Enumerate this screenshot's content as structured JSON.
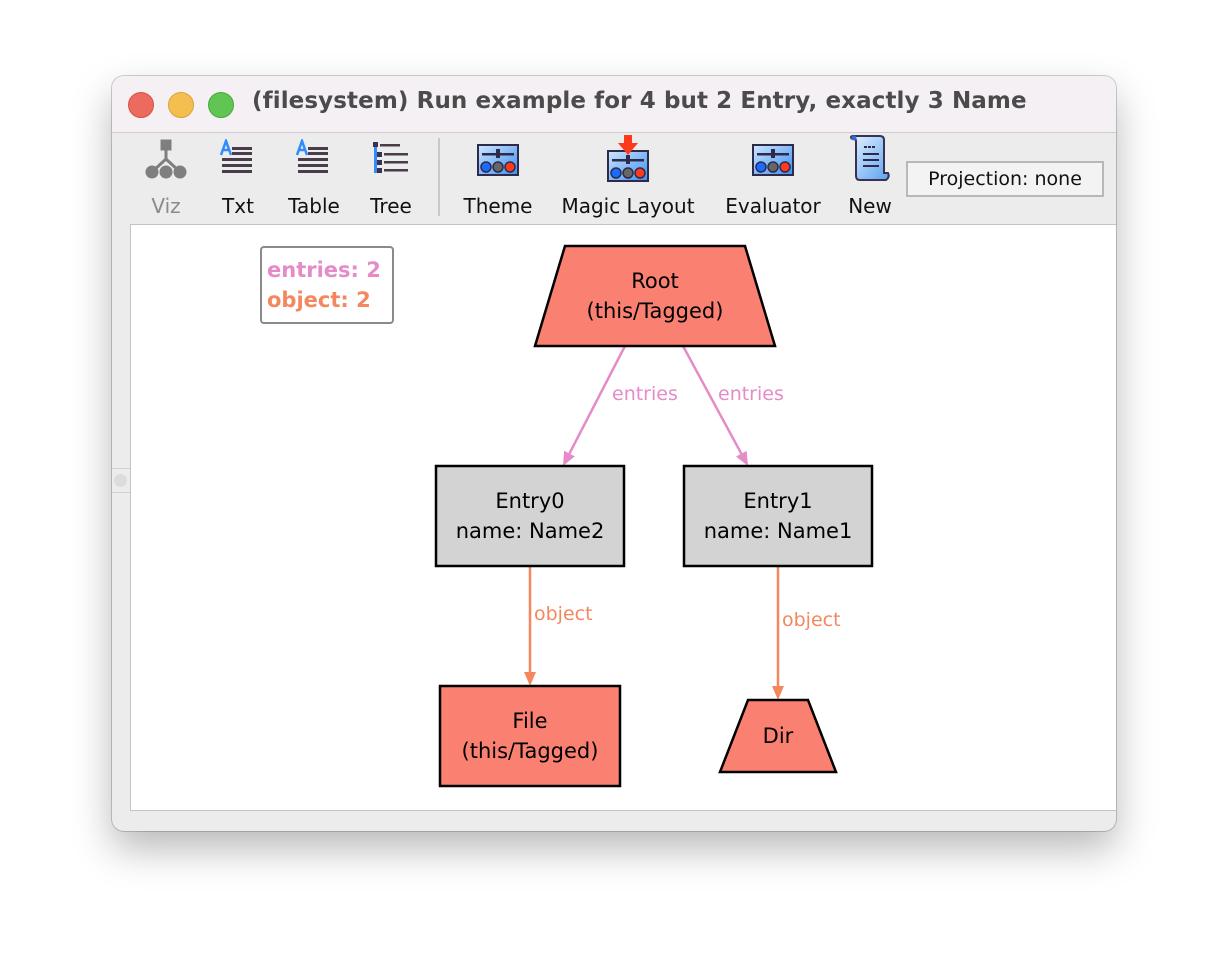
{
  "window": {
    "title": "(filesystem) Run example for 4 but 2 Entry, exactly 3 Name"
  },
  "toolbar": {
    "buttons": [
      {
        "id": "viz",
        "label": "Viz",
        "icon": "graph-tree-icon",
        "enabled": false
      },
      {
        "id": "txt",
        "label": "Txt",
        "icon": "text-lines-icon",
        "enabled": true
      },
      {
        "id": "table",
        "label": "Table",
        "icon": "table-text-icon",
        "enabled": true
      },
      {
        "id": "tree",
        "label": "Tree",
        "icon": "tree-list-icon",
        "enabled": true
      },
      {
        "id": "theme",
        "label": "Theme",
        "icon": "slider-panel-icon",
        "enabled": true
      },
      {
        "id": "magic-layout",
        "label": "Magic Layout",
        "icon": "slider-panel-arrow-icon",
        "enabled": true
      },
      {
        "id": "evaluator",
        "label": "Evaluator",
        "icon": "slider-panel-icon",
        "enabled": true
      },
      {
        "id": "new",
        "label": "New",
        "icon": "scroll-icon",
        "enabled": true
      }
    ],
    "projection_label": "Projection: none"
  },
  "legend": {
    "items": [
      {
        "label": "entries: 2",
        "color": "#e58bc7"
      },
      {
        "label": "object: 2",
        "color": "#f4875e"
      }
    ]
  },
  "graph": {
    "colors": {
      "atom_fill": "#fa8072",
      "entry_fill": "#d3d3d3",
      "entries_edge": "#e58bc7",
      "object_edge": "#f4875e",
      "outline": "#000000"
    },
    "nodes": [
      {
        "id": "root",
        "shape": "trapezium",
        "lines": [
          "Root",
          "(this/Tagged)"
        ]
      },
      {
        "id": "entry0",
        "shape": "box",
        "lines": [
          "Entry0",
          "name: Name2"
        ]
      },
      {
        "id": "entry1",
        "shape": "box",
        "lines": [
          "Entry1",
          "name: Name1"
        ]
      },
      {
        "id": "file",
        "shape": "box",
        "lines": [
          "File",
          "(this/Tagged)"
        ]
      },
      {
        "id": "dir",
        "shape": "trapezium",
        "lines": [
          "Dir"
        ]
      }
    ],
    "edges": [
      {
        "from": "root",
        "to": "entry0",
        "label": "entries",
        "relation": "entries"
      },
      {
        "from": "root",
        "to": "entry1",
        "label": "entries",
        "relation": "entries"
      },
      {
        "from": "entry0",
        "to": "file",
        "label": "object",
        "relation": "object"
      },
      {
        "from": "entry1",
        "to": "dir",
        "label": "object",
        "relation": "object"
      }
    ]
  }
}
